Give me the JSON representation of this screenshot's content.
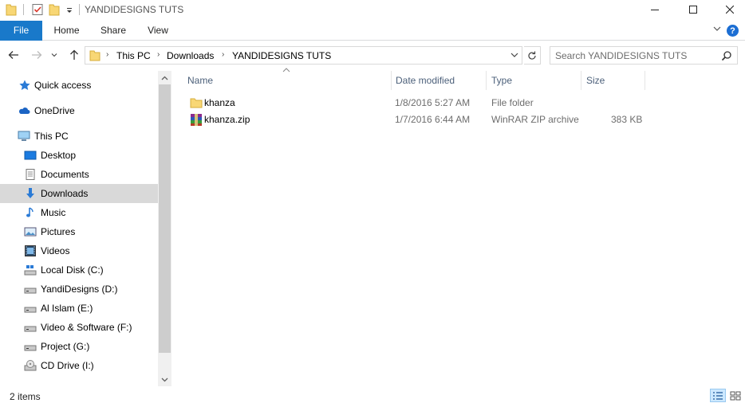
{
  "window": {
    "title": "YANDIDESIGNS TUTS",
    "minimize": "—",
    "maximize": "☐",
    "close": "✕"
  },
  "ribbon": {
    "tabs": [
      "File",
      "Home",
      "Share",
      "View"
    ],
    "help": "?"
  },
  "address": {
    "crumbs": [
      "This PC",
      "Downloads",
      "YANDIDESIGNS TUTS"
    ],
    "search_placeholder": "Search YANDIDESIGNS TUTS"
  },
  "nav": {
    "items": [
      {
        "label": "Quick access",
        "icon": "star-icon"
      },
      {
        "label": "OneDrive",
        "icon": "cloud-icon"
      },
      {
        "label": "This PC",
        "icon": "computer-icon"
      },
      {
        "label": "Desktop",
        "icon": "desktop-icon"
      },
      {
        "label": "Documents",
        "icon": "documents-icon"
      },
      {
        "label": "Downloads",
        "icon": "download-arrow-icon"
      },
      {
        "label": "Music",
        "icon": "music-note-icon"
      },
      {
        "label": "Pictures",
        "icon": "pictures-icon"
      },
      {
        "label": "Videos",
        "icon": "videos-icon"
      },
      {
        "label": "Local Disk (C:)",
        "icon": "system-drive-icon"
      },
      {
        "label": "YandiDesigns (D:)",
        "icon": "drive-icon"
      },
      {
        "label": "Al Islam (E:)",
        "icon": "drive-icon"
      },
      {
        "label": "Video & Software (F:)",
        "icon": "drive-icon"
      },
      {
        "label": "Project (G:)",
        "icon": "drive-icon"
      },
      {
        "label": "CD Drive (I:)",
        "icon": "cd-drive-icon"
      }
    ],
    "selected": "Downloads"
  },
  "columns": [
    "Name",
    "Date modified",
    "Type",
    "Size"
  ],
  "files": [
    {
      "name": "khanza",
      "date": "1/8/2016 5:27 AM",
      "type": "File folder",
      "size": "",
      "icon": "folder-icon"
    },
    {
      "name": "khanza.zip",
      "date": "1/7/2016 6:44 AM",
      "type": "WinRAR ZIP archive",
      "size": "383 KB",
      "icon": "winrar-archive-icon"
    }
  ],
  "status": {
    "item_count": "2 items"
  },
  "colors": {
    "accent": "#1979ca",
    "selected_bg": "#d9d9d9",
    "header_text": "#4c607a",
    "meta_text": "#6d6d6d"
  }
}
